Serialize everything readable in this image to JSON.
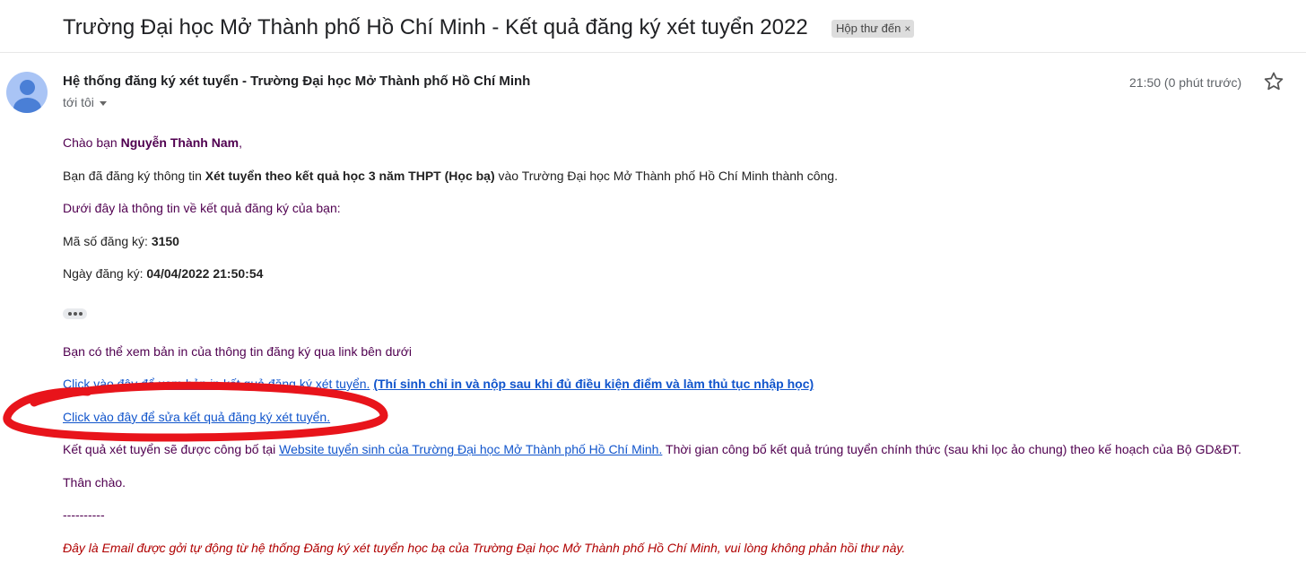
{
  "subject": "Trường Đại học Mở Thành phố Hồ Chí Minh - Kết quả đăng ký xét tuyển 2022",
  "label": {
    "text": "Hộp thư đến",
    "close": "×"
  },
  "sender": {
    "name": "Hệ thống đăng ký xét tuyển - Trường Đại học Mở Thành phố Hồ Chí Minh",
    "to": "tới tôi",
    "time": "21:50 (0 phút trước)"
  },
  "icons": {
    "avatar": "person-avatar-icon",
    "star": "star-outline-icon",
    "caret": "chevron-down-icon",
    "more": "ellipsis-icon"
  },
  "colors": {
    "purple_text": "#500050",
    "link": "#1155cc",
    "footer": "#b00000",
    "annotation": "#e8141b"
  },
  "body": {
    "greeting_pre": "Chào bạn ",
    "greeting_name": "Nguyễn Thành Nam",
    "greeting_post": ",",
    "registered_pre": "Bạn đã đăng ký thông tin ",
    "registered_bold": "Xét tuyển theo kết quả học 3 năm THPT (Học bạ)",
    "registered_post": " vào Trường Đại học Mở Thành phố Hồ Chí Minh thành công.",
    "info_intro": "Dưới đây là thông tin về kết quả đăng ký của bạn:",
    "reg_code_label": "Mã số đăng ký: ",
    "reg_code_value": "3150",
    "reg_date_label": "Ngày đăng ký: ",
    "reg_date_value": "04/04/2022 21:50:54",
    "print_intro": "Bạn có thể xem bản in của thông tin đăng ký qua link bên dưới",
    "print_link": "Click vào đây để xem bản in kết quả đăng ký xét tuyển.",
    "print_link_note": "(Thí sinh chỉ in và nộp sau khi đủ điều kiện điểm và làm thủ tục nhập học)",
    "edit_link": "Click vào đây để sửa kết quả đăng ký xét tuyển.",
    "announce_pre": "Kết quả xét tuyển sẽ được công bố tại ",
    "announce_link": "Website tuyển sinh của Trường Đại học Mở Thành phố Hồ Chí Minh.",
    "announce_post": " Thời gian công bố kết quả trúng tuyển chính thức (sau khi lọc ảo chung) theo kế hoạch của Bộ GD&ĐT.",
    "closing": "Thân chào.",
    "divider": "----------",
    "footer": "Đây là Email được gởi tự động từ hệ thống Đăng ký xét tuyển học bạ của Trường Đại học Mở Thành phố Hồ Chí Minh, vui lòng không phản hồi thư này."
  }
}
